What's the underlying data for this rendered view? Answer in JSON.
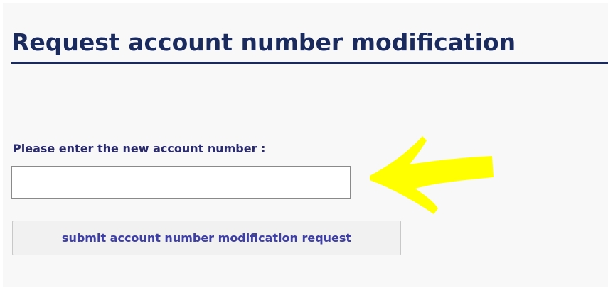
{
  "page": {
    "title": "Request account number modification"
  },
  "form": {
    "label": "Please enter the new account number :",
    "input_value": "",
    "input_placeholder": "",
    "submit_label": "submit account number modification request"
  },
  "annotation": {
    "arrow_color": "#ffff00",
    "arrow_icon": "arrow-left-icon"
  }
}
